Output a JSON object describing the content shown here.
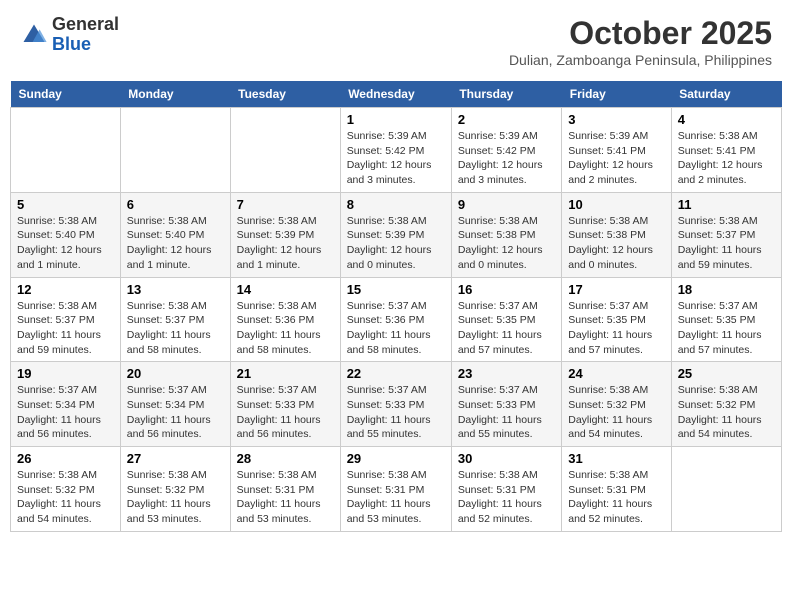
{
  "header": {
    "logo_general": "General",
    "logo_blue": "Blue",
    "month": "October 2025",
    "location": "Dulian, Zamboanga Peninsula, Philippines"
  },
  "days_of_week": [
    "Sunday",
    "Monday",
    "Tuesday",
    "Wednesday",
    "Thursday",
    "Friday",
    "Saturday"
  ],
  "weeks": [
    [
      {
        "day": "",
        "info": ""
      },
      {
        "day": "",
        "info": ""
      },
      {
        "day": "",
        "info": ""
      },
      {
        "day": "1",
        "info": "Sunrise: 5:39 AM\nSunset: 5:42 PM\nDaylight: 12 hours\nand 3 minutes."
      },
      {
        "day": "2",
        "info": "Sunrise: 5:39 AM\nSunset: 5:42 PM\nDaylight: 12 hours\nand 3 minutes."
      },
      {
        "day": "3",
        "info": "Sunrise: 5:39 AM\nSunset: 5:41 PM\nDaylight: 12 hours\nand 2 minutes."
      },
      {
        "day": "4",
        "info": "Sunrise: 5:38 AM\nSunset: 5:41 PM\nDaylight: 12 hours\nand 2 minutes."
      }
    ],
    [
      {
        "day": "5",
        "info": "Sunrise: 5:38 AM\nSunset: 5:40 PM\nDaylight: 12 hours\nand 1 minute."
      },
      {
        "day": "6",
        "info": "Sunrise: 5:38 AM\nSunset: 5:40 PM\nDaylight: 12 hours\nand 1 minute."
      },
      {
        "day": "7",
        "info": "Sunrise: 5:38 AM\nSunset: 5:39 PM\nDaylight: 12 hours\nand 1 minute."
      },
      {
        "day": "8",
        "info": "Sunrise: 5:38 AM\nSunset: 5:39 PM\nDaylight: 12 hours\nand 0 minutes."
      },
      {
        "day": "9",
        "info": "Sunrise: 5:38 AM\nSunset: 5:38 PM\nDaylight: 12 hours\nand 0 minutes."
      },
      {
        "day": "10",
        "info": "Sunrise: 5:38 AM\nSunset: 5:38 PM\nDaylight: 12 hours\nand 0 minutes."
      },
      {
        "day": "11",
        "info": "Sunrise: 5:38 AM\nSunset: 5:37 PM\nDaylight: 11 hours\nand 59 minutes."
      }
    ],
    [
      {
        "day": "12",
        "info": "Sunrise: 5:38 AM\nSunset: 5:37 PM\nDaylight: 11 hours\nand 59 minutes."
      },
      {
        "day": "13",
        "info": "Sunrise: 5:38 AM\nSunset: 5:37 PM\nDaylight: 11 hours\nand 58 minutes."
      },
      {
        "day": "14",
        "info": "Sunrise: 5:38 AM\nSunset: 5:36 PM\nDaylight: 11 hours\nand 58 minutes."
      },
      {
        "day": "15",
        "info": "Sunrise: 5:37 AM\nSunset: 5:36 PM\nDaylight: 11 hours\nand 58 minutes."
      },
      {
        "day": "16",
        "info": "Sunrise: 5:37 AM\nSunset: 5:35 PM\nDaylight: 11 hours\nand 57 minutes."
      },
      {
        "day": "17",
        "info": "Sunrise: 5:37 AM\nSunset: 5:35 PM\nDaylight: 11 hours\nand 57 minutes."
      },
      {
        "day": "18",
        "info": "Sunrise: 5:37 AM\nSunset: 5:35 PM\nDaylight: 11 hours\nand 57 minutes."
      }
    ],
    [
      {
        "day": "19",
        "info": "Sunrise: 5:37 AM\nSunset: 5:34 PM\nDaylight: 11 hours\nand 56 minutes."
      },
      {
        "day": "20",
        "info": "Sunrise: 5:37 AM\nSunset: 5:34 PM\nDaylight: 11 hours\nand 56 minutes."
      },
      {
        "day": "21",
        "info": "Sunrise: 5:37 AM\nSunset: 5:33 PM\nDaylight: 11 hours\nand 56 minutes."
      },
      {
        "day": "22",
        "info": "Sunrise: 5:37 AM\nSunset: 5:33 PM\nDaylight: 11 hours\nand 55 minutes."
      },
      {
        "day": "23",
        "info": "Sunrise: 5:37 AM\nSunset: 5:33 PM\nDaylight: 11 hours\nand 55 minutes."
      },
      {
        "day": "24",
        "info": "Sunrise: 5:38 AM\nSunset: 5:32 PM\nDaylight: 11 hours\nand 54 minutes."
      },
      {
        "day": "25",
        "info": "Sunrise: 5:38 AM\nSunset: 5:32 PM\nDaylight: 11 hours\nand 54 minutes."
      }
    ],
    [
      {
        "day": "26",
        "info": "Sunrise: 5:38 AM\nSunset: 5:32 PM\nDaylight: 11 hours\nand 54 minutes."
      },
      {
        "day": "27",
        "info": "Sunrise: 5:38 AM\nSunset: 5:32 PM\nDaylight: 11 hours\nand 53 minutes."
      },
      {
        "day": "28",
        "info": "Sunrise: 5:38 AM\nSunset: 5:31 PM\nDaylight: 11 hours\nand 53 minutes."
      },
      {
        "day": "29",
        "info": "Sunrise: 5:38 AM\nSunset: 5:31 PM\nDaylight: 11 hours\nand 53 minutes."
      },
      {
        "day": "30",
        "info": "Sunrise: 5:38 AM\nSunset: 5:31 PM\nDaylight: 11 hours\nand 52 minutes."
      },
      {
        "day": "31",
        "info": "Sunrise: 5:38 AM\nSunset: 5:31 PM\nDaylight: 11 hours\nand 52 minutes."
      },
      {
        "day": "",
        "info": ""
      }
    ]
  ]
}
